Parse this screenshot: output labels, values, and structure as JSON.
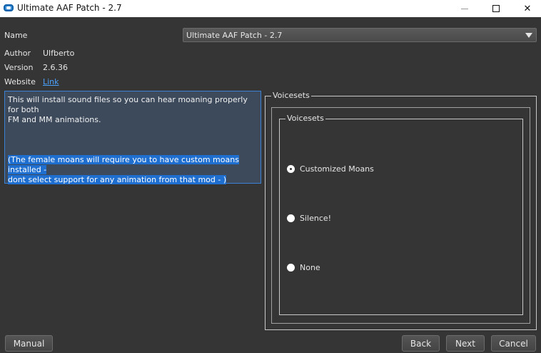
{
  "window": {
    "title": "Ultimate AAF Patch - 2.7",
    "minimize_icon": "minimize-icon",
    "maximize_icon": "maximize-icon",
    "close_icon": "close-icon",
    "close_glyph": "✕"
  },
  "info": {
    "name_label": "Name",
    "name_value": "Ultimate AAF Patch - 2.7",
    "author_label": "Author",
    "author_value": "Ulfberto",
    "version_label": "Version",
    "version_value": "2.6.36",
    "website_label": "Website",
    "website_link": "Link"
  },
  "description": {
    "line1": "This will install sound files so you can hear moaning properly for both",
    "line2": "FM and MM animations.",
    "highlight1": "(The female moans will require you to have custom moans installed -",
    "highlight2": "dont select support for any animation from that mod - )"
  },
  "voicesets": {
    "outer_title": "Voicesets",
    "inner_title": "Voicesets",
    "options": [
      {
        "label": "Customized Moans",
        "checked": true
      },
      {
        "label": "Silence!",
        "checked": false
      },
      {
        "label": "None",
        "checked": false
      }
    ]
  },
  "buttons": {
    "manual": "Manual",
    "back": "Back",
    "next": "Next",
    "cancel": "Cancel"
  },
  "colors": {
    "background": "#353535",
    "accent": "#3b82d6",
    "link": "#4aa3ff",
    "selection": "#1f6fd1"
  }
}
